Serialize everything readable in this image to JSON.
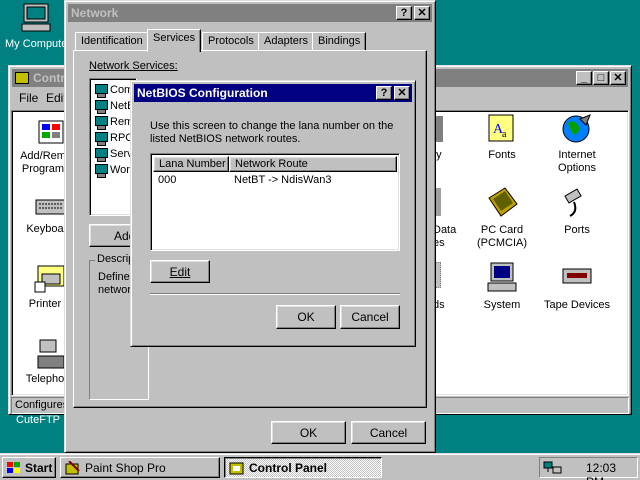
{
  "desktop": {
    "my_computer_label": "My Computer",
    "cuteftp_label": "CuteFTP"
  },
  "control_panel": {
    "title": "Control Panel",
    "menu": [
      "File",
      "Edit"
    ],
    "status_text": "Configures",
    "icons_left": [
      "Add/Remove Programs",
      "Keyboard",
      "Printers",
      "Telephony"
    ],
    "icons_left_partial": [
      "Add/Rem\nProgram",
      "Keyboa",
      "Printer",
      "Telepho"
    ],
    "icons_mid_partial": [
      "ay",
      "Data\nes",
      "ds"
    ],
    "icons_right": [
      {
        "label": "Fonts",
        "icon": "fonts-icon"
      },
      {
        "label": "Internet\nOptions",
        "icon": "internet-options-icon"
      },
      {
        "label": "PC Card\n(PCMCIA)",
        "icon": "pc-card-icon"
      },
      {
        "label": "Ports",
        "icon": "ports-icon"
      },
      {
        "label": "System",
        "icon": "system-icon"
      },
      {
        "label": "Tape Devices",
        "icon": "tape-devices-icon"
      }
    ]
  },
  "network": {
    "title": "Network",
    "tabs": [
      "Identification",
      "Services",
      "Protocols",
      "Adapters",
      "Bindings"
    ],
    "selected_tab": "Services",
    "services_label": "Network Services:",
    "services": [
      "Com",
      "NetB",
      "Rem",
      "RPC",
      "Serv",
      "Worl"
    ],
    "add_label": "Add",
    "description_label": "Descrip",
    "description_text_1": "Defines",
    "description_text_2": "network",
    "ok_label": "OK",
    "cancel_label": "Cancel"
  },
  "netbios": {
    "title": "NetBIOS Configuration",
    "instructions_1": "Use this screen to change the lana number on the",
    "instructions_2": "listed NetBIOS network routes.",
    "columns": [
      "Lana Number",
      "Network Route"
    ],
    "rows": [
      {
        "lana": "000",
        "route": "NetBT -> NdisWan3"
      }
    ],
    "edit_label": "Edit",
    "ok_label": "OK",
    "cancel_label": "Cancel"
  },
  "taskbar": {
    "start_label": "Start",
    "tasks": [
      {
        "label": "Paint Shop Pro",
        "active": false
      },
      {
        "label": "Control Panel",
        "active": true
      }
    ],
    "clock": "12:03 PM"
  },
  "title_buttons": {
    "help": "?",
    "close": "✕",
    "minimize": "_",
    "maximize": "□"
  }
}
